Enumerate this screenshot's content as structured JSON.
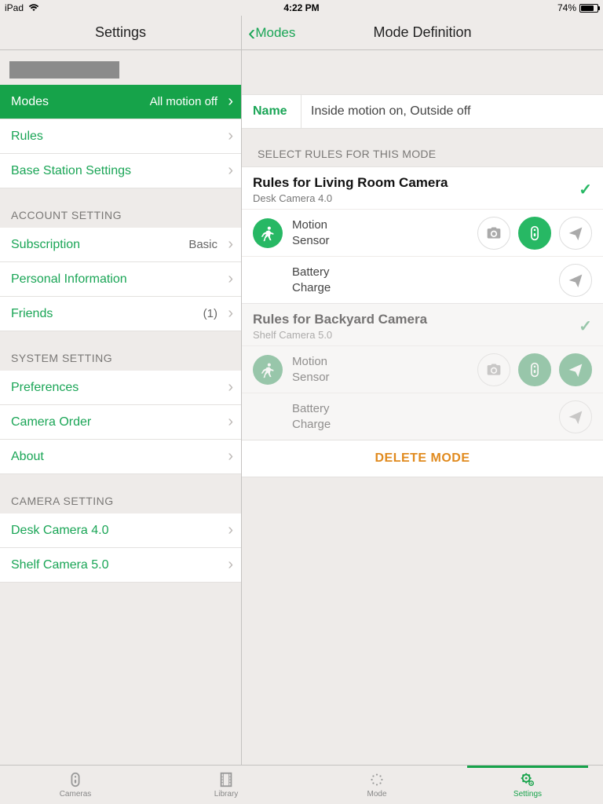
{
  "status": {
    "device": "iPad",
    "time": "4:22 PM",
    "battery_pct": "74%"
  },
  "header": {
    "left_title": "Settings",
    "back_label": "Modes",
    "right_title": "Mode Definition"
  },
  "sidebar": {
    "groups": [
      {
        "header": "",
        "items": [
          {
            "label": "Modes",
            "value": "All motion off",
            "selected": true
          },
          {
            "label": "Rules",
            "value": ""
          },
          {
            "label": "Base Station Settings",
            "value": ""
          }
        ]
      },
      {
        "header": "ACCOUNT SETTING",
        "items": [
          {
            "label": "Subscription",
            "value": "Basic"
          },
          {
            "label": "Personal Information",
            "value": ""
          },
          {
            "label": "Friends",
            "value": "(1)"
          }
        ]
      },
      {
        "header": "SYSTEM SETTING",
        "items": [
          {
            "label": "Preferences",
            "value": ""
          },
          {
            "label": "Camera Order",
            "value": ""
          },
          {
            "label": "About",
            "value": ""
          }
        ]
      },
      {
        "header": "CAMERA SETTING",
        "items": [
          {
            "label": "Desk Camera 4.0",
            "value": ""
          },
          {
            "label": "Shelf Camera 5.0",
            "value": ""
          }
        ]
      }
    ]
  },
  "main": {
    "name_label": "Name",
    "name_value": "Inside motion on, Outside off",
    "select_header": "SELECT RULES FOR THIS MODE",
    "rules": [
      {
        "title": "Rules for Living Room Camera",
        "subtitle": "Desk Camera 4.0",
        "checked": true,
        "lines": [
          {
            "icon": "motion",
            "label_a": "Motion",
            "label_b": "Sensor",
            "actions": [
              {
                "type": "camera",
                "on": false
              },
              {
                "type": "record",
                "on": true
              },
              {
                "type": "send",
                "on": false
              }
            ]
          },
          {
            "icon": "",
            "label_a": "Battery",
            "label_b": "Charge",
            "actions": [
              {
                "type": "send",
                "on": false
              }
            ]
          }
        ]
      },
      {
        "title": "Rules for Backyard Camera",
        "subtitle": "Shelf Camera 5.0",
        "checked": false,
        "lines": [
          {
            "icon": "motion",
            "label_a": "Motion",
            "label_b": "Sensor",
            "actions": [
              {
                "type": "camera",
                "on": false
              },
              {
                "type": "record",
                "on": true
              },
              {
                "type": "send",
                "on": true
              }
            ]
          },
          {
            "icon": "",
            "label_a": "Battery",
            "label_b": "Charge",
            "actions": [
              {
                "type": "send",
                "on": false
              }
            ]
          }
        ]
      }
    ],
    "delete_label": "DELETE MODE"
  },
  "tabs": [
    {
      "label": "Cameras",
      "icon": "camera-device"
    },
    {
      "label": "Library",
      "icon": "film"
    },
    {
      "label": "Mode",
      "icon": "spinner"
    },
    {
      "label": "Settings",
      "icon": "gears"
    }
  ]
}
